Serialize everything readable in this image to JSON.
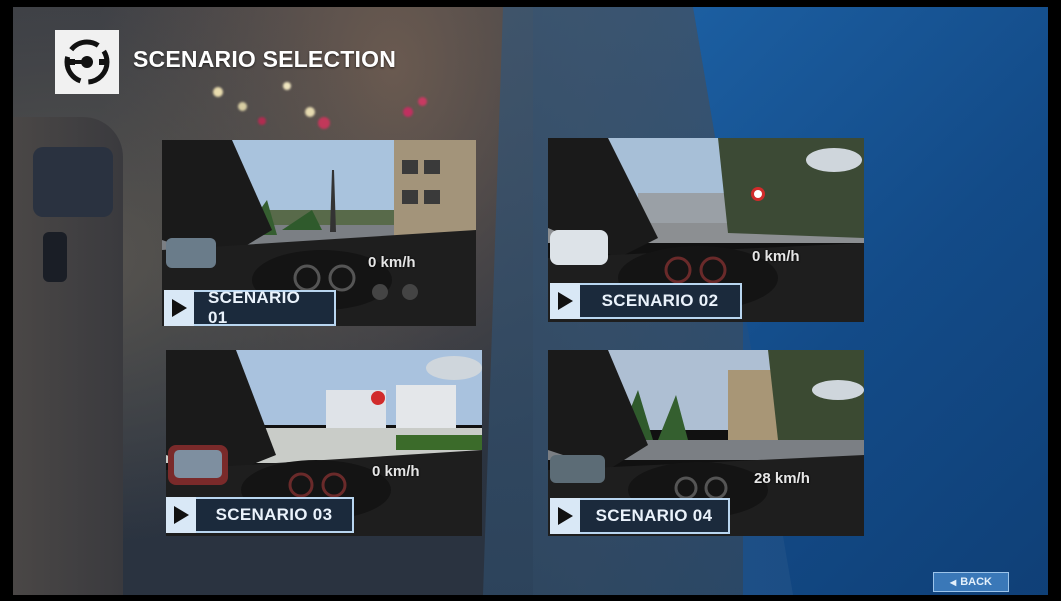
{
  "header": {
    "title": "SCENARIO SELECTION",
    "logo_icon": "steering-wheel-icon"
  },
  "scenarios": [
    {
      "label": "SCENARIO 01",
      "speed": "0 km/h"
    },
    {
      "label": "SCENARIO 02",
      "speed": "0 km/h"
    },
    {
      "label": "SCENARIO 03",
      "speed": "0 km/h"
    },
    {
      "label": "SCENARIO 04",
      "speed": "28 km/h"
    }
  ],
  "footer": {
    "back_label": "BACK",
    "back_icon": "left-arrow-icon"
  },
  "colors": {
    "accent_blue": "#1c5fa2",
    "label_bg": "#1b2a3c",
    "label_border": "#b9d6f0",
    "play_bg": "#d9e8f6"
  }
}
